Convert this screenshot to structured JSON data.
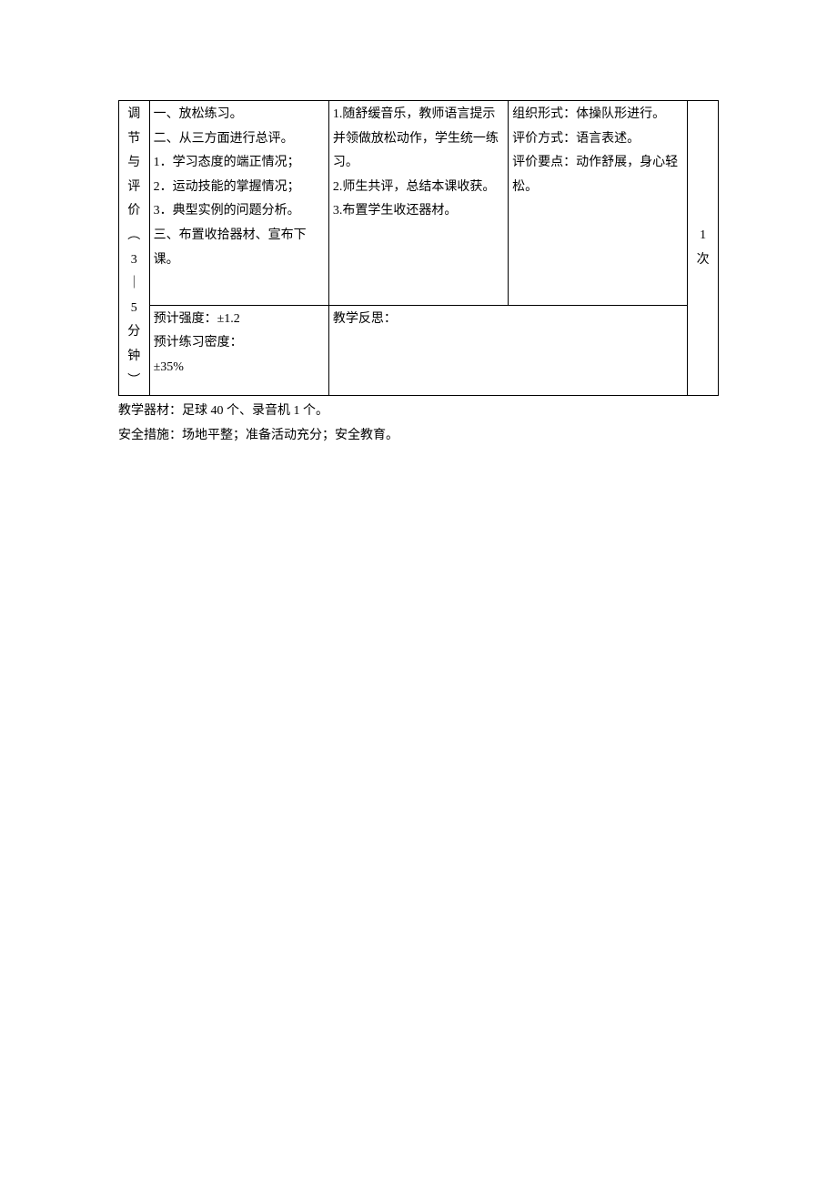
{
  "table": {
    "row1": {
      "phase": "调节与评价︵3｜5分钟︶",
      "content_lines": [
        "一、放松练习。",
        "二、从三方面进行总评。",
        "1．学习态度的端正情况；",
        "2．运动技能的掌握情况；",
        "3．典型实例的问题分析。",
        "三、布置收拾器材、宣布下课。"
      ],
      "method_lines": [
        "1.随舒缓音乐，教师语言提示并领做放松动作，学生统一练习。",
        "2.师生共评，总结本课收获。",
        "3.布置学生收还器材。"
      ],
      "org_lines": [
        "组织形式：体操队形进行。",
        "评价方式：语言表述。",
        "评价要点：动作舒展，身心轻松。"
      ],
      "times": "1次"
    },
    "row2": {
      "col1_lines": [
        "预计强度：±1.2",
        "预计练习密度：",
        "±35%"
      ],
      "col2_label": "教学反思："
    }
  },
  "footer": {
    "equipment": "教学器材：足球 40 个、录音机 1 个。",
    "safety": "安全措施：场地平整；准备活动充分；安全教育。"
  }
}
